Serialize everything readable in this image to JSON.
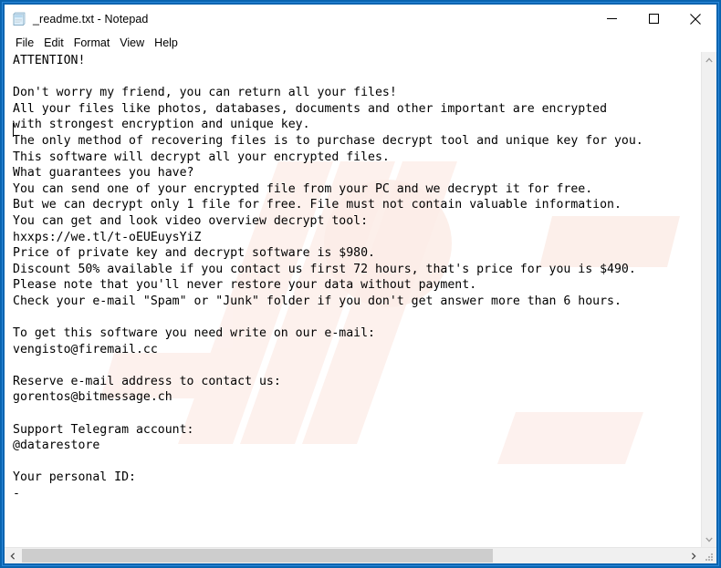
{
  "window": {
    "title": "_readme.txt - Notepad",
    "icon": "notepad-document-icon",
    "frame_color": "#0964b0",
    "background_color": "#ffffff",
    "controls": {
      "minimize_label": "Minimize",
      "maximize_label": "Maximize",
      "close_label": "Close"
    }
  },
  "menu": {
    "items": [
      {
        "label": "File"
      },
      {
        "label": "Edit"
      },
      {
        "label": "Format"
      },
      {
        "label": "View"
      },
      {
        "label": "Help"
      }
    ]
  },
  "document": {
    "filename": "_readme.txt",
    "body": "ATTENTION!\n\nDon't worry my friend, you can return all your files!\nAll your files like photos, databases, documents and other important are encrypted\nwith strongest encryption and unique key.\nThe only method of recovering files is to purchase decrypt tool and unique key for you.\nThis software will decrypt all your encrypted files.\nWhat guarantees you have?\nYou can send one of your encrypted file from your PC and we decrypt it for free.\nBut we can decrypt only 1 file for free. File must not contain valuable information.\nYou can get and look video overview decrypt tool:\nhxxps://we.tl/t-oEUEuysYiZ\nPrice of private key and decrypt software is $980.\nDiscount 50% available if you contact us first 72 hours, that's price for you is $490.\nPlease note that you'll never restore your data without payment.\nCheck your e-mail \"Spam\" or \"Junk\" folder if you don't get answer more than 6 hours.\n\nTo get this software you need write on our e-mail:\nvengisto@firemail.cc\n\nReserve e-mail address to contact us:\ngorentos@bitmessage.ch\n\nSupport Telegram account:\n@datarestore\n\nYour personal ID:\n-",
    "details": {
      "video_url": "hxxps://we.tl/t-oEUEuysYiZ",
      "price_full": "$980",
      "price_discount": "$490",
      "discount_percent": "50%",
      "discount_window_hours": "72",
      "answer_within_hours": "6",
      "primary_email": "vengisto@firemail.cc",
      "reserve_email": "gorentos@bitmessage.ch",
      "telegram_account": "@datarestore",
      "personal_id": "-"
    }
  },
  "scrollbars": {
    "vertical": {
      "up_arrow": "chevron-up",
      "down_arrow": "chevron-down"
    },
    "horizontal": {
      "left_arrow": "chevron-left",
      "right_arrow": "chevron-right"
    },
    "resize_grip": "resize-grip"
  }
}
